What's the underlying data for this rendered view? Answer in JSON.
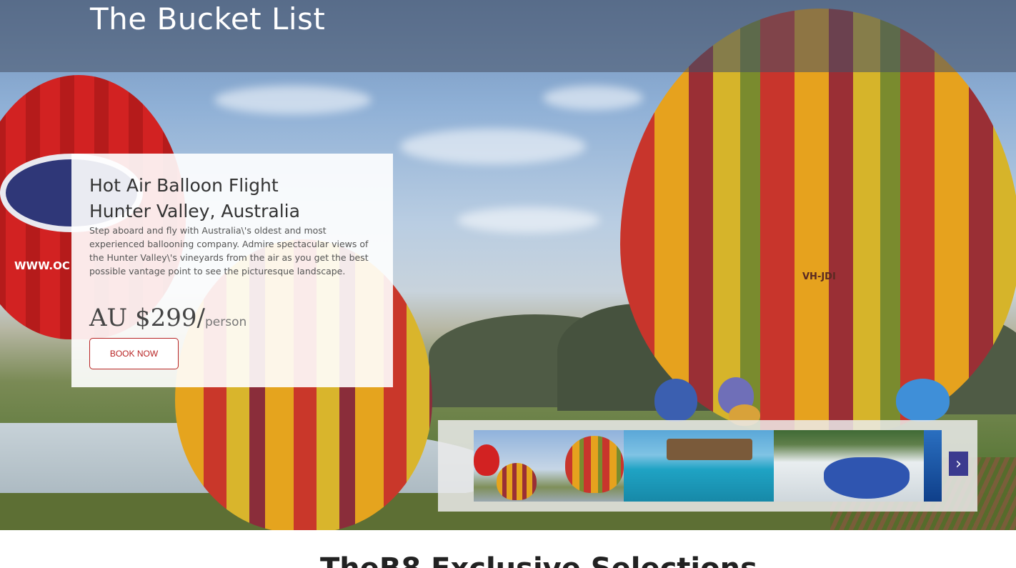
{
  "header": {
    "title": "The Bucket List"
  },
  "card": {
    "title_line1": "Hot Air Balloon Flight",
    "title_line2": "Hunter Valley, Australia",
    "description": "Step aboard and fly with Australia\\'s oldest and most experienced ballooning company. Admire spectacular views of the Hunter Valley\\'s vineyards from the air as you get the best possible vantage point to see the picturesque landscape.",
    "price": "AU $299/",
    "price_unit": "person",
    "cta_label": "BOOK NOW"
  },
  "balloon_text": {
    "registration": "VH-JDI",
    "website": "WWW.OC"
  },
  "carousel": {
    "next_icon": "chevron-right-icon",
    "next_glyph": "›"
  },
  "section": {
    "heading": "TheB8 Exclusive Selections"
  },
  "colors": {
    "accent": "#b82424",
    "carousel_button": "#3b3a8f"
  }
}
